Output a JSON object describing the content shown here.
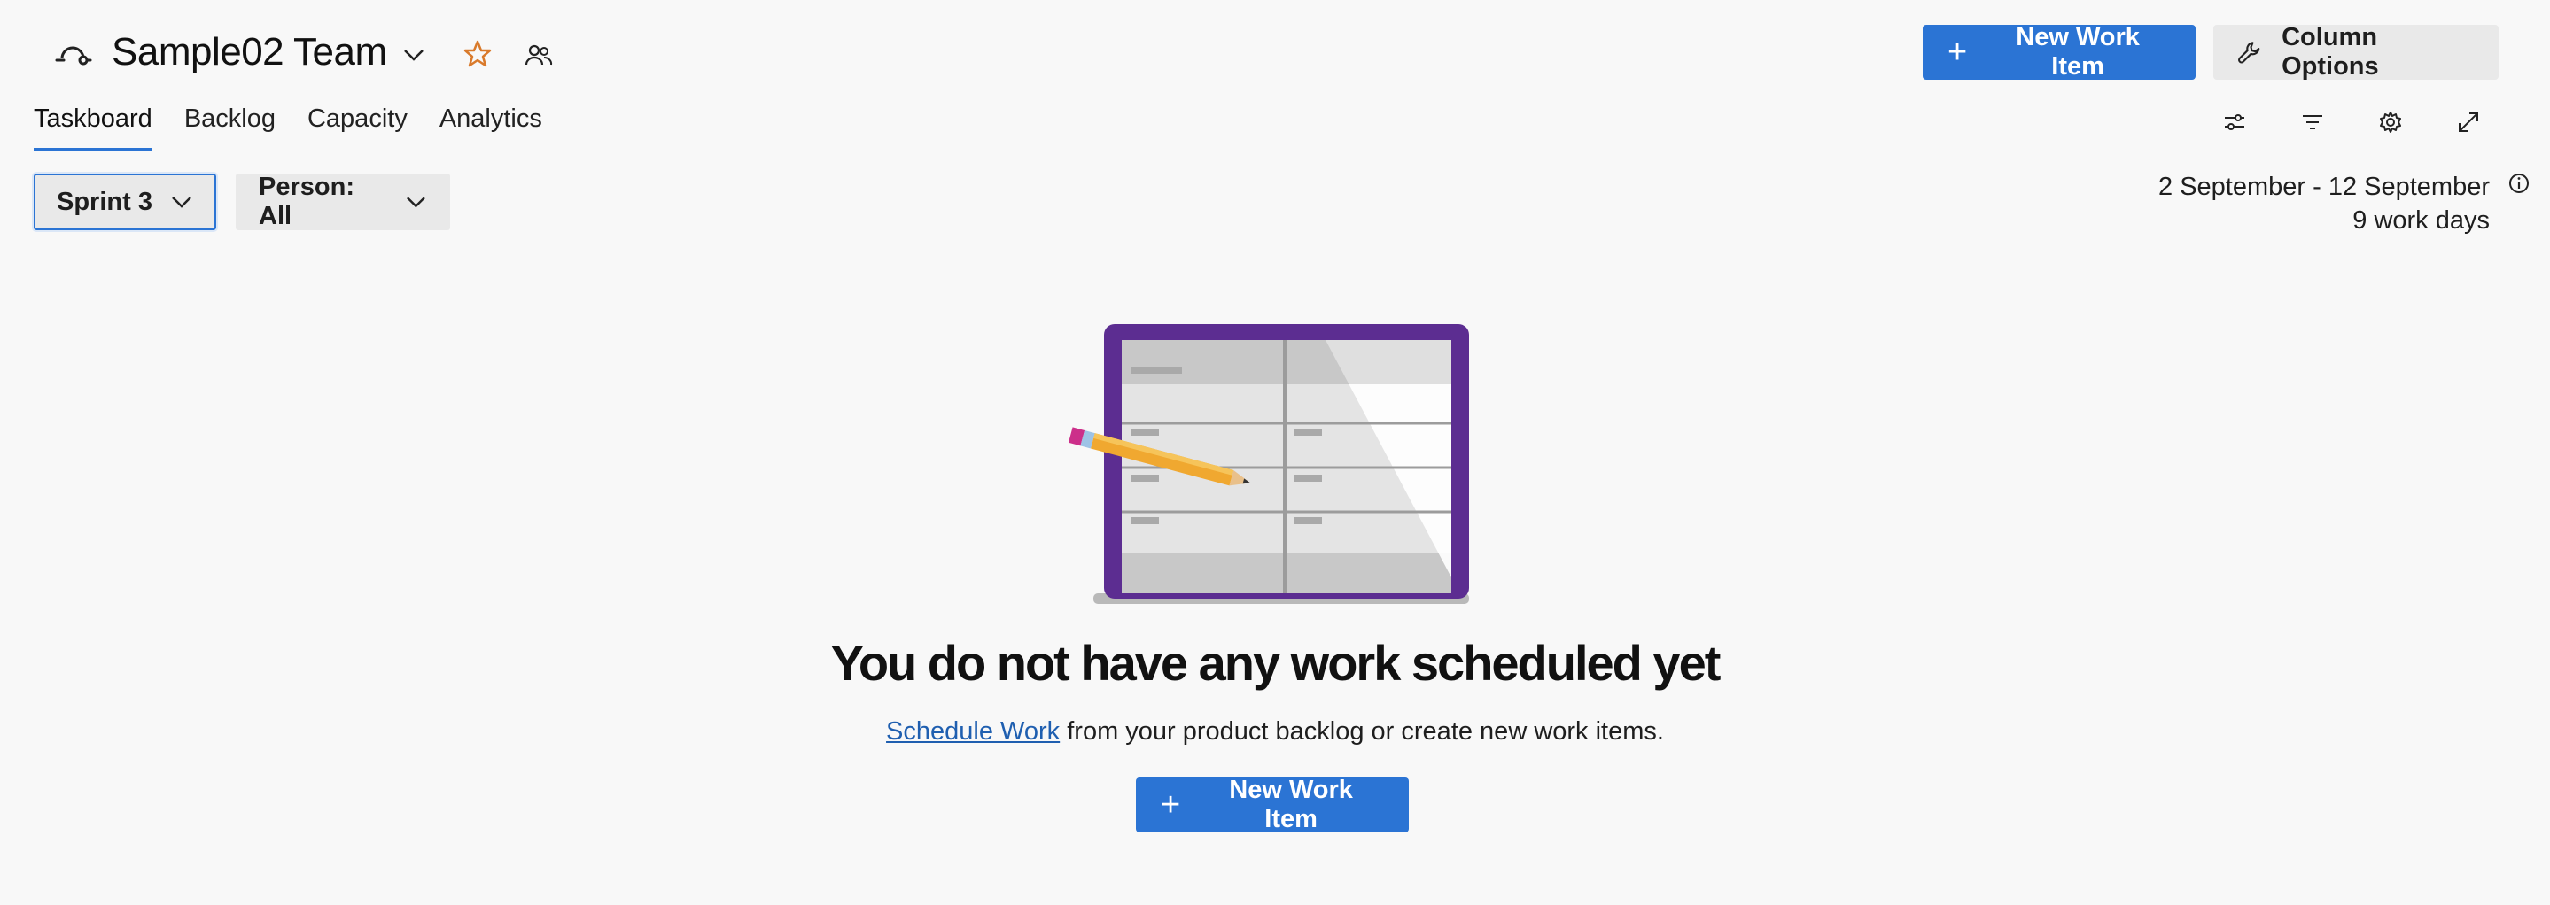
{
  "header": {
    "team_name": "Sample02 Team",
    "new_work_item_label": "New Work Item",
    "column_options_label": "Column Options"
  },
  "tabs": [
    {
      "label": "Taskboard",
      "active": true
    },
    {
      "label": "Backlog",
      "active": false
    },
    {
      "label": "Capacity",
      "active": false
    },
    {
      "label": "Analytics",
      "active": false
    }
  ],
  "toolbar": {
    "icons": [
      "view-options-icon",
      "filter-icon",
      "settings-icon",
      "fullscreen-icon"
    ]
  },
  "filters": {
    "sprint_label": "Sprint 3",
    "person_label": "Person: All"
  },
  "sprint_info": {
    "date_range": "2 September - 12 September",
    "work_days": "9 work days"
  },
  "empty_state": {
    "title": "You do not have any work scheduled yet",
    "link_text": "Schedule Work",
    "subtitle_rest": " from your product backlog or create new work items.",
    "button_label": "New Work Item"
  },
  "colors": {
    "accent": "#2b74d4",
    "star": "#d97a2b",
    "illustration_frame": "#5c2d91",
    "pencil": "#f0a830"
  }
}
